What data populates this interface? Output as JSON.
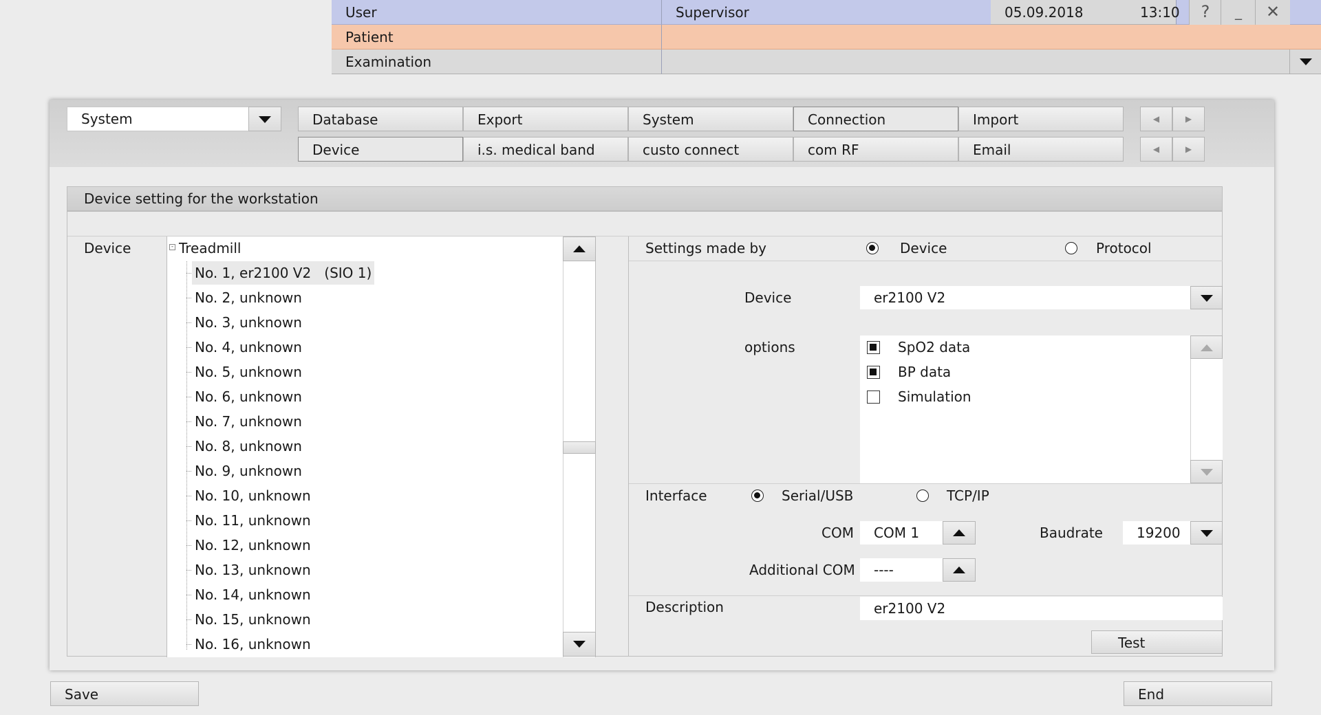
{
  "header": {
    "user_label": "User",
    "user_value": "Supervisor",
    "date": "05.09.2018",
    "time": "13:10",
    "help_symbol": "?",
    "minimize_symbol": "_",
    "close_symbol": "✕",
    "patient_label": "Patient",
    "examination_label": "Examination"
  },
  "toolbar": {
    "dropdown_value": "System",
    "tabs_row1": [
      "Database",
      "Export",
      "System",
      "Connection",
      "Import"
    ],
    "tabs_row2": [
      "Device",
      "i.s. medical band",
      "custo connect",
      "com RF",
      "Email"
    ],
    "active_row1": "Connection",
    "active_row2": "Device"
  },
  "section": {
    "title": "Device setting for the workstation",
    "device_label": "Device"
  },
  "tree": {
    "root": "Treadmill",
    "items": [
      {
        "no": "No. 1,",
        "name": "er2100 V2   (SIO 1)"
      },
      {
        "no": "No. 2,",
        "name": "unknown"
      },
      {
        "no": "No. 3,",
        "name": "unknown"
      },
      {
        "no": "No. 4,",
        "name": "unknown"
      },
      {
        "no": "No. 5,",
        "name": "unknown"
      },
      {
        "no": "No. 6,",
        "name": "unknown"
      },
      {
        "no": "No. 7,",
        "name": "unknown"
      },
      {
        "no": "No. 8,",
        "name": "unknown"
      },
      {
        "no": "No. 9,",
        "name": "unknown"
      },
      {
        "no": "No. 10,",
        "name": "unknown"
      },
      {
        "no": "No. 11,",
        "name": "unknown"
      },
      {
        "no": "No. 12,",
        "name": "unknown"
      },
      {
        "no": "No. 13,",
        "name": "unknown"
      },
      {
        "no": "No. 14,",
        "name": "unknown"
      },
      {
        "no": "No. 15,",
        "name": "unknown"
      },
      {
        "no": "No. 16,",
        "name": "unknown"
      }
    ]
  },
  "settings": {
    "made_by_label": "Settings made by",
    "made_by_device": "Device",
    "made_by_protocol": "Protocol",
    "device_label": "Device",
    "device_value": "er2100 V2",
    "options_label": "options",
    "options": [
      {
        "label": "SpO2 data",
        "checked": true
      },
      {
        "label": "BP data",
        "checked": true
      },
      {
        "label": "Simulation",
        "checked": false
      }
    ],
    "interface_label": "Interface",
    "interface_serial": "Serial/USB",
    "interface_tcp": "TCP/IP",
    "com_label": "COM",
    "com_value": "COM 1",
    "baudrate_label": "Baudrate",
    "baudrate_value": "19200",
    "additional_com_label": "Additional COM",
    "additional_com_value": "----",
    "description_label": "Description",
    "description_value": "er2100 V2",
    "test_button": "Test"
  },
  "footer": {
    "save_button": "Save",
    "end_button": "End"
  }
}
